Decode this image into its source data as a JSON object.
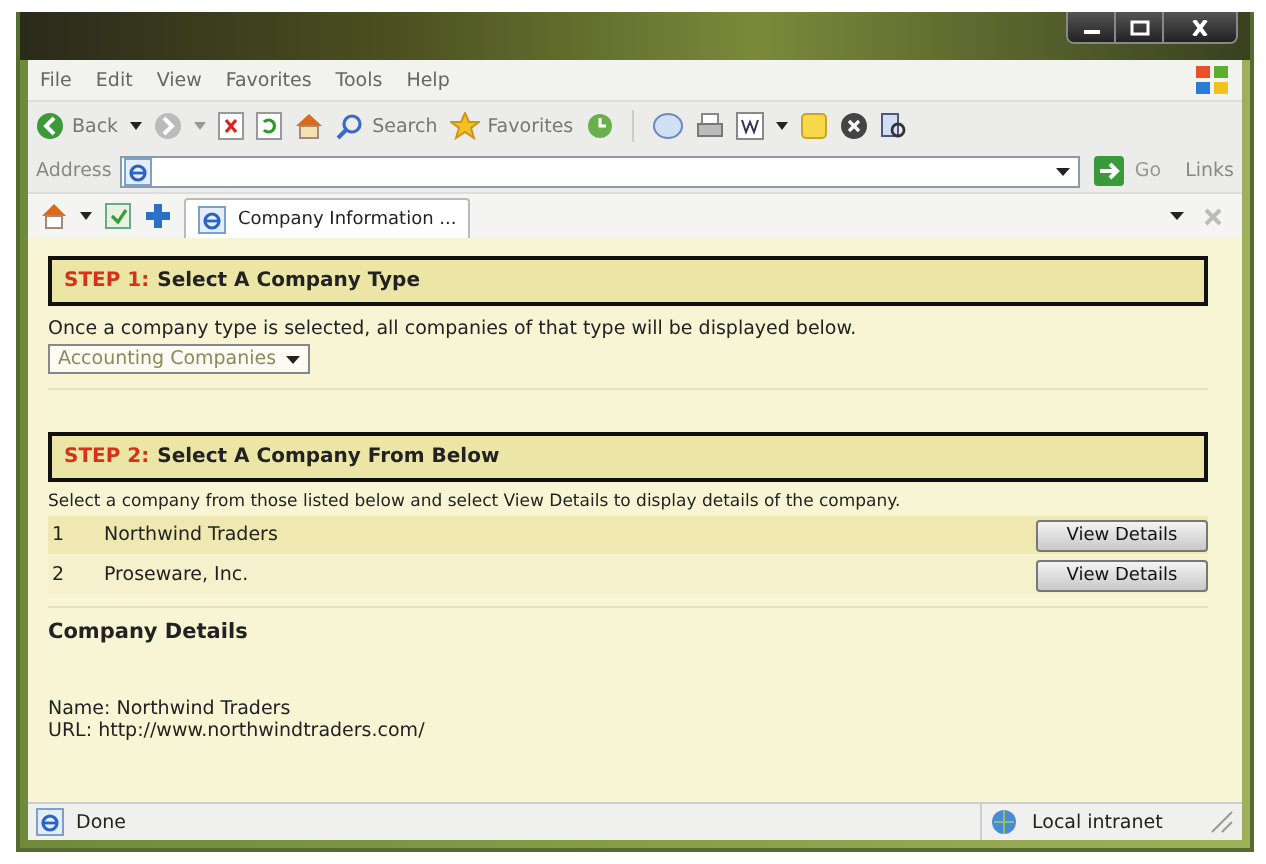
{
  "menu": [
    "File",
    "Edit",
    "View",
    "Favorites",
    "Tools",
    "Help"
  ],
  "toolbar": {
    "back": "Back",
    "search": "Search",
    "favorites": "Favorites"
  },
  "address": {
    "label": "Address",
    "go": "Go",
    "links": "Links"
  },
  "tab": {
    "title": "Company Information ..."
  },
  "step1": {
    "step": "STEP 1:",
    "title": "Select A Company Type",
    "text": "Once a company type is selected, all companies of that type will be displayed below.",
    "dropdown": "Accounting Companies"
  },
  "step2": {
    "step": "STEP 2:",
    "title": "Select A Company From Below",
    "text": "Select a company from those listed below and select View Details to display details of the company.",
    "companies": [
      {
        "number": "1",
        "name": "Northwind Traders",
        "button": "View Details",
        "selected": true
      },
      {
        "number": "2",
        "name": "Proseware, Inc.",
        "button": "View Details",
        "selected": false
      }
    ]
  },
  "details": {
    "heading": "Company Details",
    "lines": [
      "Name: Northwind Traders",
      "URL: http://www.northwindtraders.com/"
    ]
  },
  "status": {
    "text": "Done",
    "zone": "Local intranet"
  }
}
